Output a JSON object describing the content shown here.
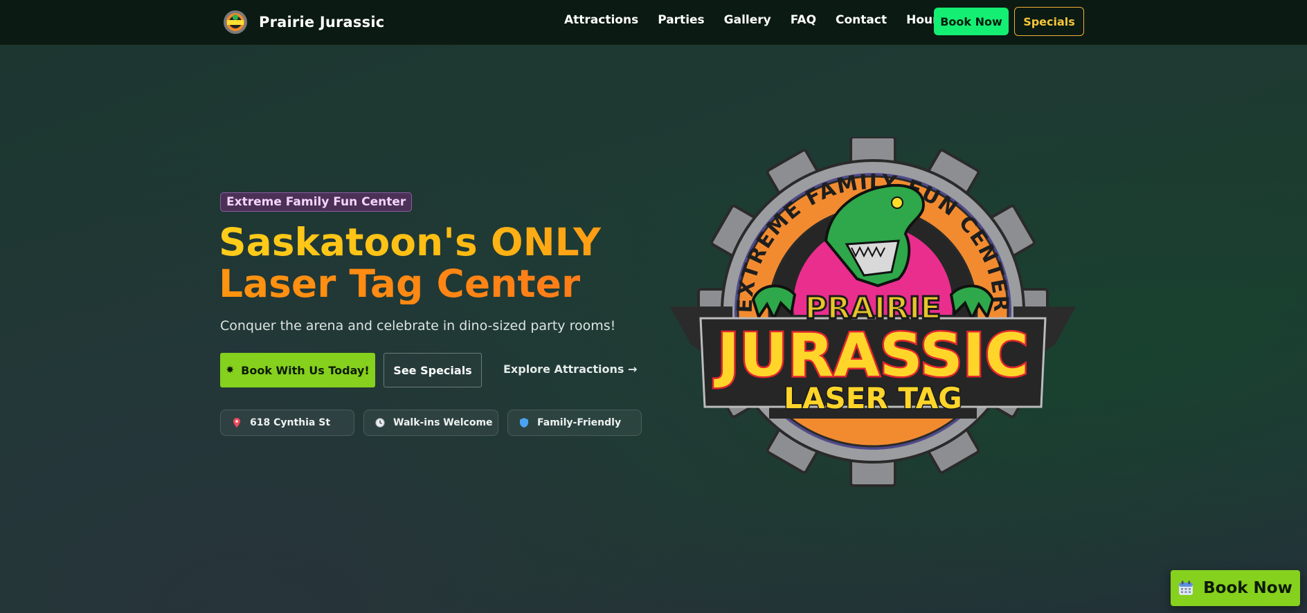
{
  "brand": {
    "name": "Prairie Jurassic",
    "logo_icon": "prairie-jurassic-logo-icon"
  },
  "nav": {
    "links": [
      "Attractions",
      "Parties",
      "Gallery",
      "FAQ",
      "Contact",
      "Hours"
    ],
    "book_label": "Book Now",
    "specials_label": "Specials"
  },
  "hero": {
    "tagline": "Extreme Family Fun Center",
    "title_line1": "Saskatoon's ONLY",
    "title_line2": "Laser Tag Center",
    "subtitle": "Conquer the arena and celebrate in dino-sized party rooms!",
    "primary_cta": "Book With Us Today!",
    "primary_cta_icon": "star-burst-icon",
    "secondary_cta": "See Specials",
    "tertiary_cta": "Explore Attractions →",
    "chips": [
      {
        "icon": "pin-icon",
        "label": "618 Cynthia St"
      },
      {
        "icon": "clock-icon",
        "label": "Walk-ins Welcome"
      },
      {
        "icon": "shield-icon",
        "label": "Family-Friendly"
      }
    ]
  },
  "emblem": {
    "ring_text": "EXTREME FAMILY FUN CENTER",
    "top_word": "PRAIRIE",
    "main_word": "JURASSIC",
    "bottom_word": "LASER TAG"
  },
  "floating": {
    "label": "Book Now",
    "icon": "calendar-icon"
  },
  "colors": {
    "accent_green": "#86d01e",
    "nav_book_green": "#14ee72",
    "gold": "#ffcd1a",
    "orange": "#ff8614",
    "nav_bg": "#0b1a12"
  }
}
